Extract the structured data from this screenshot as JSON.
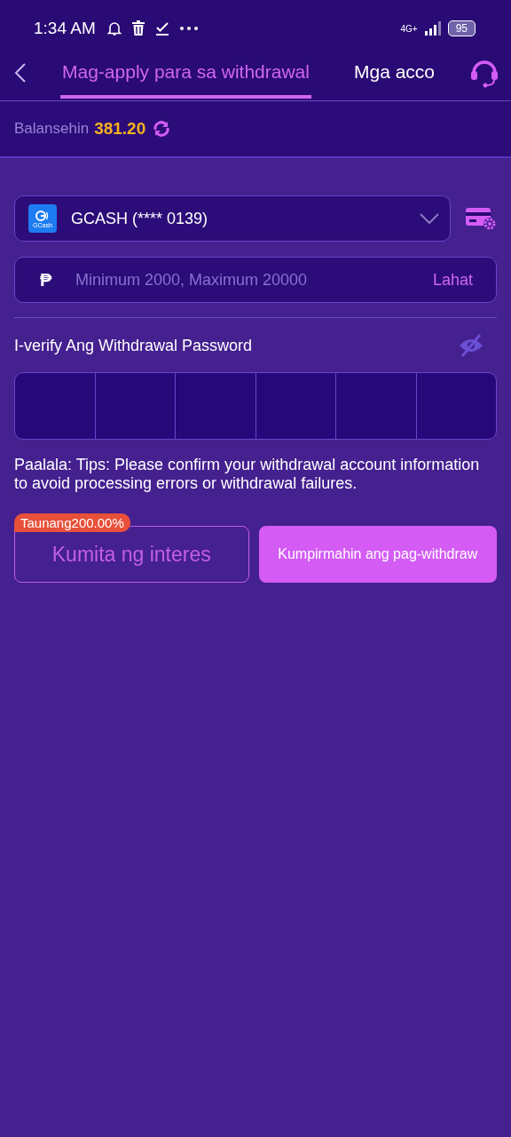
{
  "status_bar": {
    "time": "1:34 AM",
    "network": "4G+",
    "battery": "95"
  },
  "tabs": [
    {
      "label": "Mag-apply para sa withdrawal",
      "selected": true
    },
    {
      "label": "Mga acco",
      "selected": false
    }
  ],
  "balance": {
    "label": "Balansehin",
    "amount": "381.20"
  },
  "account": {
    "name": "GCASH (**** 0139)",
    "logo_text": "GCash"
  },
  "amount_field": {
    "currency": "₱",
    "placeholder": "Minimum 2000, Maximum 20000",
    "all_button": "Lahat"
  },
  "password": {
    "label": "I-verify Ang Withdrawal Password",
    "visible": false
  },
  "tip": "Paalala: Tips: Please confirm your withdrawal account information to avoid processing errors or withdrawal failures.",
  "interest_button": {
    "label": "Kumita ng interes",
    "badge": "Taunang200.00%"
  },
  "confirm_button": {
    "label": "Kumpirmahin ang pag-withdraw"
  }
}
